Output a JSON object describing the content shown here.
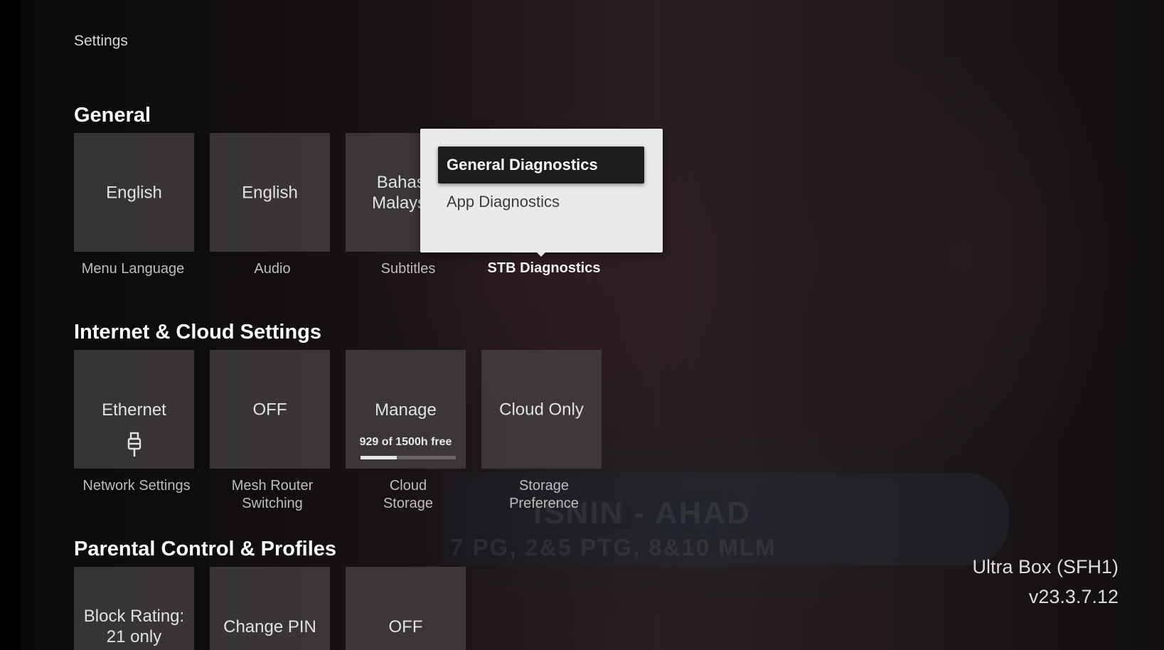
{
  "page": {
    "title": "Settings"
  },
  "background_banner": {
    "line1": "ISNIN - AHAD",
    "line2": "7 PG, 2&5 PTG, 8&10 MLM"
  },
  "sections": {
    "general": {
      "title": "General",
      "tiles": [
        {
          "value": "English",
          "label": "Menu Language"
        },
        {
          "value": "English",
          "label": "Audio"
        },
        {
          "value": "Bahasa Malaysia",
          "label": "Subtitles"
        },
        {
          "label": "STB Diagnostics"
        }
      ]
    },
    "internet": {
      "title": "Internet & Cloud Settings",
      "tiles": [
        {
          "value": "Ethernet",
          "label": "Network Settings",
          "icon": "ethernet-plug-icon"
        },
        {
          "value": "OFF",
          "label": "Mesh Router Switching"
        },
        {
          "value": "Manage",
          "label": "Cloud Storage",
          "storage_text": "929 of 1500h free",
          "storage_used_fraction": 0.38
        },
        {
          "value": "Cloud Only",
          "label": "Storage Preference"
        }
      ]
    },
    "parental": {
      "title": "Parental Control & Profiles",
      "tiles": [
        {
          "value": "Block Rating: 21 only"
        },
        {
          "value": "Change PIN"
        },
        {
          "value": "OFF"
        }
      ]
    }
  },
  "diagnostics_popup": {
    "items": [
      {
        "label": "General Diagnostics",
        "selected": true
      },
      {
        "label": "App Diagnostics",
        "selected": false
      }
    ]
  },
  "device": {
    "name": "Ultra Box (SFH1)",
    "version": "v23.3.7.12"
  },
  "colors": {
    "popup_bg": "#eaeaea",
    "selected_item_bg": "#1c1c1c",
    "tile_bg": "#444042"
  }
}
